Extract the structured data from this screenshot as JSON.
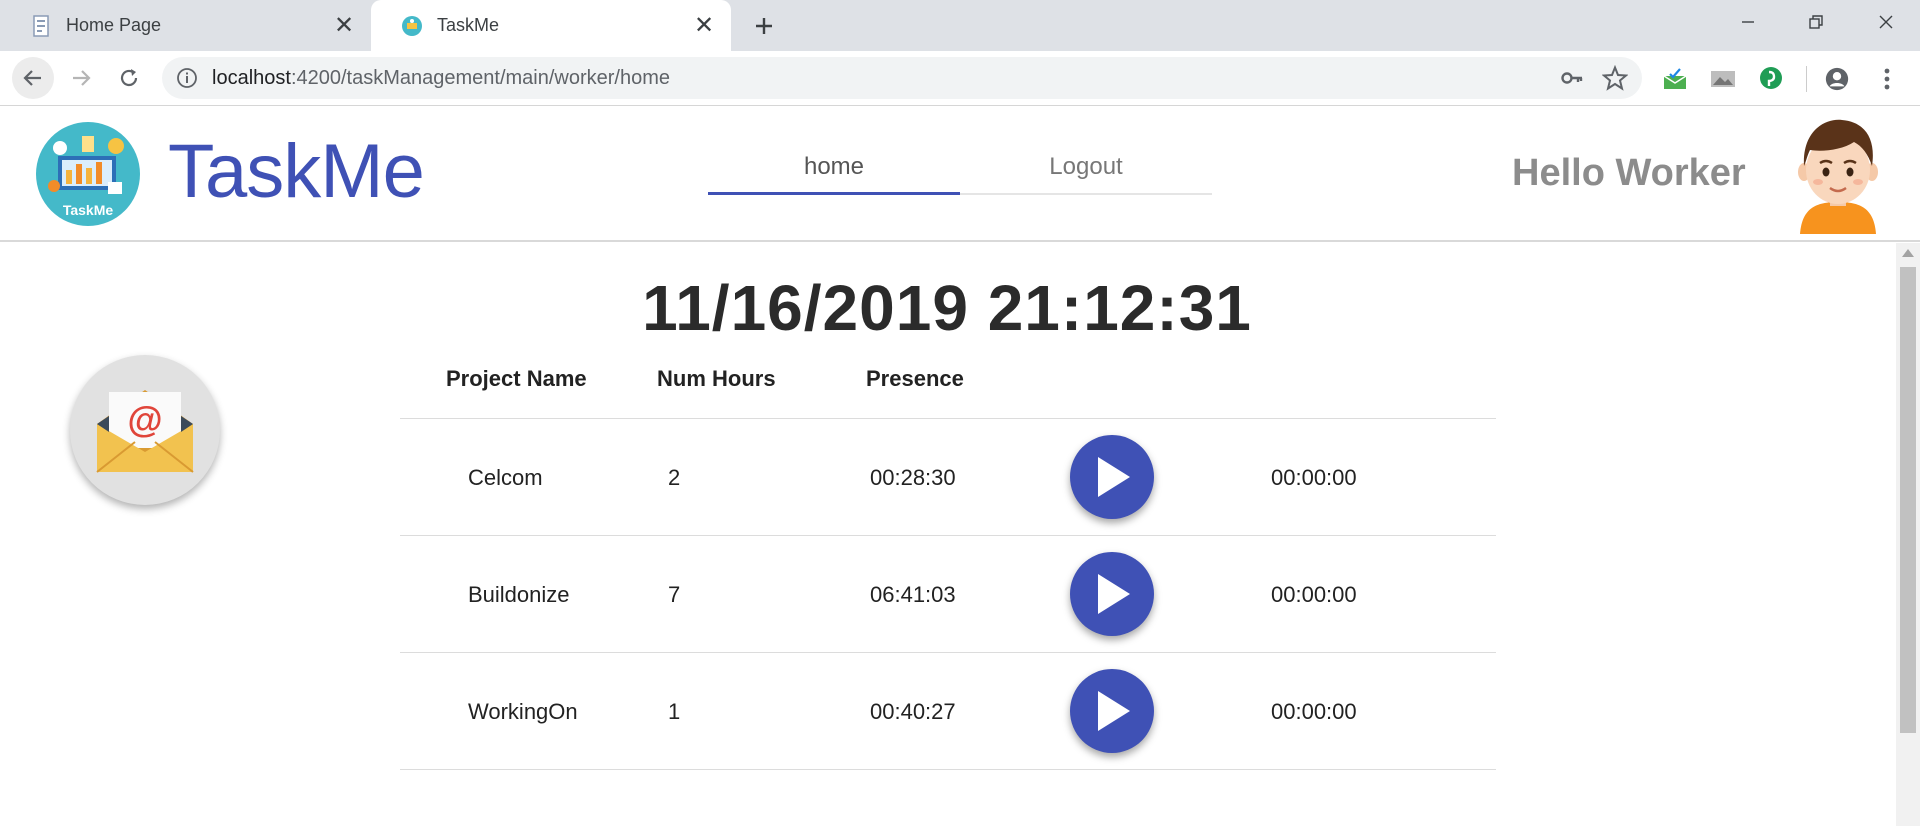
{
  "browser": {
    "tabs": [
      {
        "title": "Home Page",
        "icon": "page-icon",
        "active": false
      },
      {
        "title": "TaskMe",
        "icon": "taskme-favicon",
        "active": true
      }
    ],
    "url_host": "localhost",
    "url_path": ":4200/taskManagement/main/worker/home"
  },
  "app": {
    "brand": {
      "title": "TaskMe",
      "logo_caption": "TaskMe"
    },
    "nav": {
      "home": "home",
      "logout": "Logout",
      "active": "home"
    },
    "greeting": "Hello Worker"
  },
  "main": {
    "clock": "11/16/2019 21:12:31",
    "table": {
      "headers": {
        "project": "Project Name",
        "hours": "Num Hours",
        "presence": "Presence"
      },
      "rows": [
        {
          "project": "Celcom",
          "hours": "2",
          "presence": "00:28:30",
          "timer": "00:00:00"
        },
        {
          "project": "Buildonize",
          "hours": "7",
          "presence": "06:41:03",
          "timer": "00:00:00"
        },
        {
          "project": "WorkingOn",
          "hours": "1",
          "presence": "00:40:27",
          "timer": "00:00:00"
        }
      ]
    }
  },
  "colors": {
    "primary": "#3f51b5",
    "greeting": "#8c8c8c",
    "logo_bg": "#44b9c9"
  }
}
